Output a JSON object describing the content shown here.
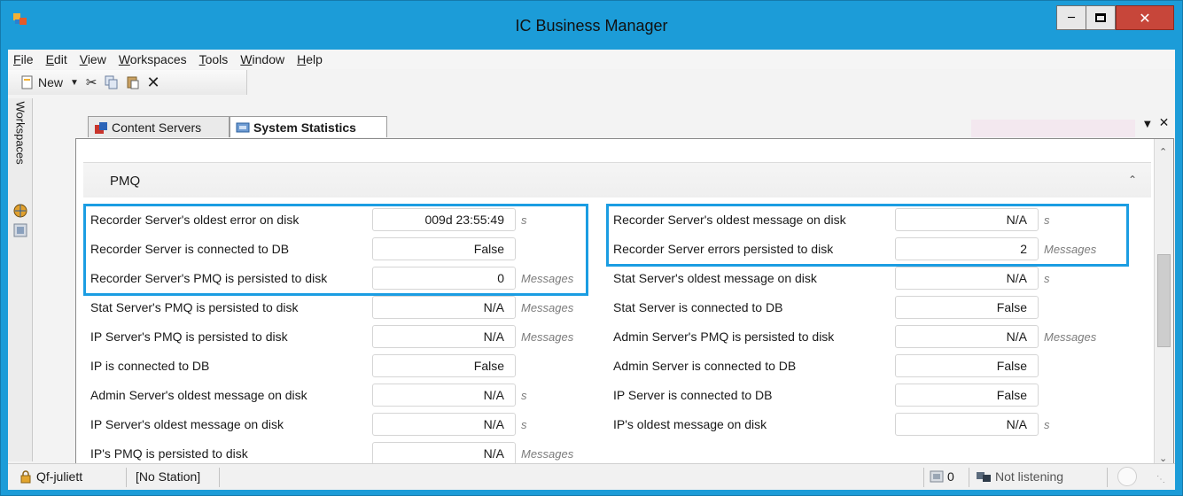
{
  "window": {
    "title": "IC Business Manager"
  },
  "menu": [
    {
      "label": "File",
      "key": "F",
      "rest": "ile"
    },
    {
      "label": "Edit",
      "key": "E",
      "rest": "dit"
    },
    {
      "label": "View",
      "key": "V",
      "rest": "iew"
    },
    {
      "label": "Workspaces",
      "key": "W",
      "rest": "orkspaces"
    },
    {
      "label": "Tools",
      "key": "T",
      "rest": "ools"
    },
    {
      "label": "Window",
      "key": "W",
      "rest": "indow"
    },
    {
      "label": "Help",
      "key": "H",
      "rest": "elp"
    }
  ],
  "toolbar": {
    "new_label": "New",
    "new_icon": "new-document-icon"
  },
  "sidebar": {
    "label": "Workspaces"
  },
  "tabs": [
    {
      "label": "Content Servers"
    },
    {
      "label": "System Statistics"
    }
  ],
  "section": {
    "title": "PMQ"
  },
  "left_stats": [
    {
      "label": "Recorder Server's oldest error on disk",
      "value": "009d 23:55:49",
      "unit": "s"
    },
    {
      "label": "Recorder Server is connected to DB",
      "value": "False",
      "unit": ""
    },
    {
      "label": "Recorder Server's PMQ is persisted to disk",
      "value": "0",
      "unit": "Messages"
    },
    {
      "label": "Stat Server's PMQ is persisted to disk",
      "value": "N/A",
      "unit": "Messages"
    },
    {
      "label": "IP Server's PMQ is persisted to disk",
      "value": "N/A",
      "unit": "Messages"
    },
    {
      "label": "IP is connected to DB",
      "value": "False",
      "unit": ""
    },
    {
      "label": "Admin Server's oldest message on disk",
      "value": "N/A",
      "unit": "s"
    },
    {
      "label": "IP Server's oldest message on disk",
      "value": "N/A",
      "unit": "s"
    },
    {
      "label": "IP's PMQ is persisted to disk",
      "value": "N/A",
      "unit": "Messages"
    }
  ],
  "right_stats": [
    {
      "label": "Recorder Server's oldest message on disk",
      "value": "N/A",
      "unit": "s"
    },
    {
      "label": "Recorder Server errors persisted to disk",
      "value": "2",
      "unit": "Messages"
    },
    {
      "label": "Stat Server's oldest message on disk",
      "value": "N/A",
      "unit": "s"
    },
    {
      "label": "Stat Server is connected to DB",
      "value": "False",
      "unit": ""
    },
    {
      "label": "Admin Server's PMQ is persisted to disk",
      "value": "N/A",
      "unit": "Messages"
    },
    {
      "label": "Admin Server is connected to DB",
      "value": "False",
      "unit": ""
    },
    {
      "label": "IP Server is connected to DB",
      "value": "False",
      "unit": ""
    },
    {
      "label": "IP's oldest message on disk",
      "value": "N/A",
      "unit": "s"
    }
  ],
  "statusbar": {
    "user": "Qf-juliett",
    "station": "[No Station]",
    "count": "0",
    "listening": "Not listening"
  },
  "colors": {
    "titlebar": "#1c9cd8",
    "highlight": "#1b9de2",
    "close": "#c7463a"
  }
}
